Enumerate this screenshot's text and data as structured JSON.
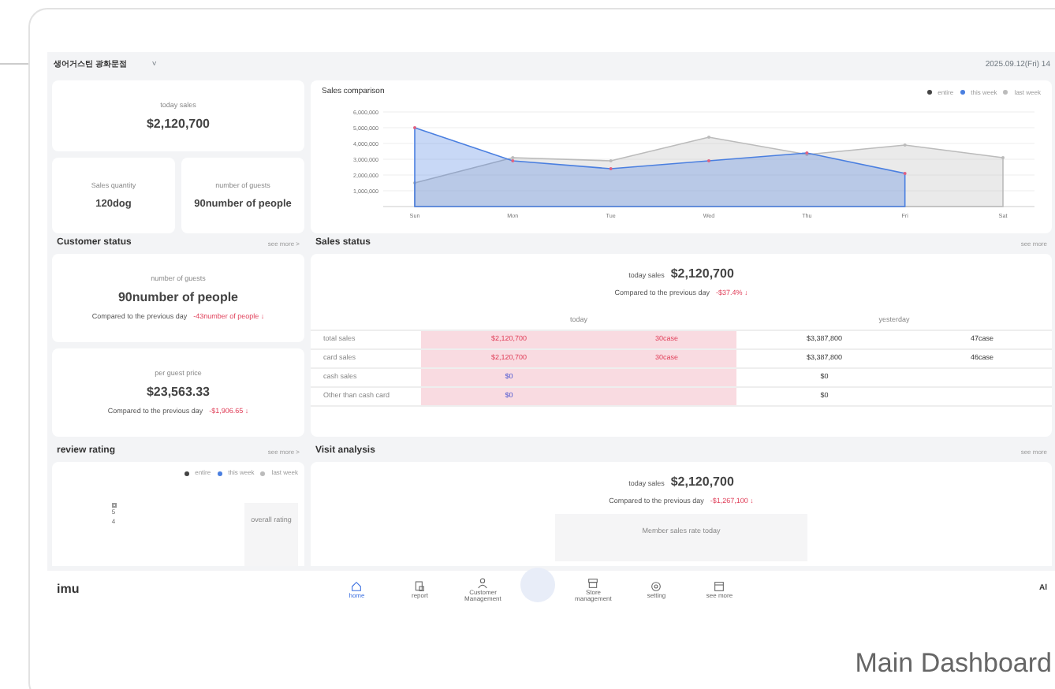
{
  "header": {
    "store": "생어거스틴 광화문점",
    "dropdown": "˅",
    "datetime": "2025.09.12(Fri) 14"
  },
  "summary": [
    {
      "kind": "wide",
      "label": "today sales",
      "value": "$2,120,700"
    },
    {
      "kind": "half",
      "label": "Sales quantity",
      "value": "120dog"
    },
    {
      "kind": "half",
      "label": "number of guests",
      "value": "90number of people"
    }
  ],
  "sales_comparison": {
    "title": "Sales comparison",
    "legend": [
      {
        "label": "entire",
        "color": "#444444"
      }
    ],
    "chart_data": {
      "type": "area",
      "grid": true,
      "categories": [
        "Sun",
        "Mon",
        "Tue",
        "Wed",
        "Thu",
        "Fri",
        "Sat"
      ],
      "ylim": [
        0,
        6000000
      ],
      "yticks": [
        {
          "value": 1000000,
          "label": "1,000,000"
        },
        {
          "value": 2000000,
          "label": "2,000,000"
        },
        {
          "value": 3000000,
          "label": "3,000,000"
        },
        {
          "value": 4000000,
          "label": "4,000,000"
        },
        {
          "value": 5000000,
          "label": "5,000,000"
        },
        {
          "value": 6000000,
          "label": "6,000,000"
        }
      ],
      "series": [
        {
          "name": "last week",
          "color": "#bbbbbb",
          "values": [
            1500000,
            3100000,
            2900000,
            4400000,
            3300000,
            3900000,
            3100000
          ]
        },
        {
          "name": "this week",
          "color": "#4a7fe0",
          "values": [
            5000000,
            2900000,
            2400000,
            2900000,
            3400000,
            2100000,
            null
          ]
        }
      ]
    }
  },
  "customer_status": {
    "title": "Customer status",
    "see_more": "see more >",
    "cards": [
      {
        "label": "number of guests",
        "value": "90number of people",
        "compare": "Compared to the previous day",
        "delta": "-43number of people ↓"
      },
      {
        "label": "per guest price",
        "value": "$23,563.33",
        "compare": "Compared to the previous day",
        "delta": "-$1,906.65 ↓"
      }
    ]
  },
  "sales_status": {
    "title": "Sales status",
    "see_more": "see more",
    "today_label": "today sales",
    "today_value": "$2,120,700",
    "compare": "Compared to the previous day",
    "delta": "-$37.4% ↓",
    "columns": [
      "today",
      "yesterday"
    ],
    "rows": [
      {
        "label": "total sales",
        "today_amount": "$2,120,700",
        "today_count": "30case",
        "yesterday_amount": "$3,387,800",
        "yesterday_count": "47case"
      },
      {
        "label": "card sales",
        "today_amount": "$2,120,700",
        "today_count": "30case",
        "yesterday_amount": "$3,387,800",
        "yesterday_count": "46case"
      },
      {
        "label": "cash sales",
        "today_amount": "$0",
        "yesterday_amount": "$0"
      },
      {
        "label": "Other than cash card",
        "today_amount": "$0",
        "yesterday_amount": "$0"
      }
    ]
  },
  "review_rating": {
    "title": "review rating",
    "see_more": "see more >",
    "legend": [
      {
        "label": "entire",
        "color": "#444444"
      },
      {
        "label": "this week",
        "color": "#4a7fe0"
      },
      {
        "label": "last week",
        "color": "#bbbbbb"
      }
    ],
    "axis_labels": [
      "5",
      "4"
    ],
    "overall": "overall rating"
  },
  "visit_analysis": {
    "title": "Visit analysis",
    "see_more": "see more",
    "today_label": "today sales",
    "today_value": "$2,120,700",
    "compare": "Compared to the previous day",
    "delta": "-$1,267,100 ↓",
    "panel": "Member sales rate today"
  },
  "nav": {
    "logo": "imu",
    "items": [
      {
        "kind": "home",
        "label": "home",
        "selected": true
      },
      {
        "kind": "report",
        "label": "report",
        "selected": false
      },
      {
        "kind": "person",
        "label": "Customer Management",
        "selected": false
      },
      {
        "kind": "fab",
        "selected": false
      },
      {
        "kind": "store",
        "label": "Store management",
        "selected": false
      },
      {
        "kind": "gear",
        "label": "setting",
        "selected": false
      },
      {
        "kind": "calendar",
        "label": "see more",
        "selected": false
      }
    ],
    "right": "Al"
  },
  "caption": "Main Dashboard"
}
